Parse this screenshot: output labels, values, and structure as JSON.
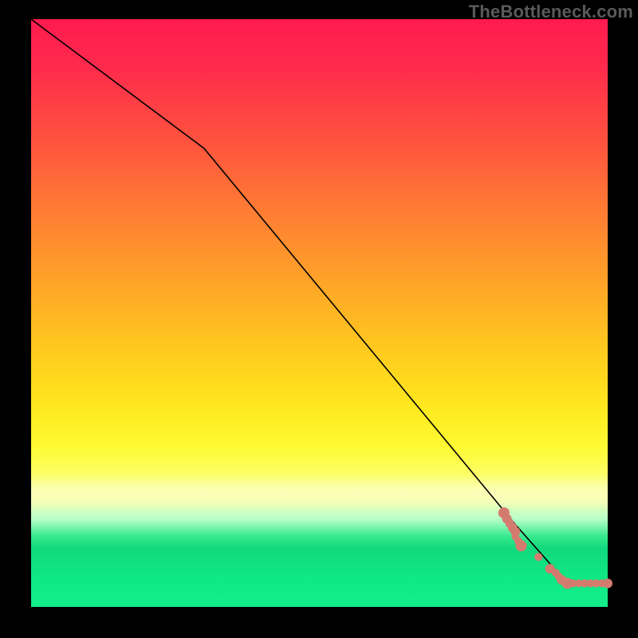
{
  "watermark": "TheBottleneck.com",
  "chart_data": {
    "type": "line",
    "title": "",
    "xlabel": "",
    "ylabel": "",
    "xlim": [
      0,
      100
    ],
    "ylim": [
      0,
      100
    ],
    "series": [
      {
        "name": "curve",
        "x": [
          0,
          30,
          84,
          93,
          100
        ],
        "y": [
          100,
          78,
          14,
          4,
          4
        ]
      }
    ],
    "markers": {
      "name": "dots",
      "x": [
        82,
        82.5,
        83,
        83.5,
        84,
        84,
        84.5,
        85,
        88,
        90,
        91,
        91.5,
        92,
        93,
        94,
        95,
        96,
        97,
        98,
        99,
        100
      ],
      "y": [
        16,
        15,
        14.2,
        13.5,
        12.8,
        12.0,
        11.2,
        10.4,
        8.5,
        6.5,
        5.8,
        5.2,
        4.6,
        4.0,
        4.0,
        4.0,
        4.0,
        4.0,
        4.0,
        4.0,
        4.0
      ],
      "r": [
        7,
        6,
        5.5,
        6,
        6,
        5,
        5,
        7,
        5,
        6,
        5,
        5,
        6,
        7,
        5,
        5,
        5,
        5,
        5,
        5,
        6
      ]
    },
    "gradient_stops": [
      {
        "pct": 0,
        "color": "#ff1a4f"
      },
      {
        "pct": 56,
        "color": "#ffc91f"
      },
      {
        "pct": 73,
        "color": "#fffb34"
      },
      {
        "pct": 88,
        "color": "#37e98f"
      },
      {
        "pct": 100,
        "color": "#13ef8a"
      }
    ]
  }
}
